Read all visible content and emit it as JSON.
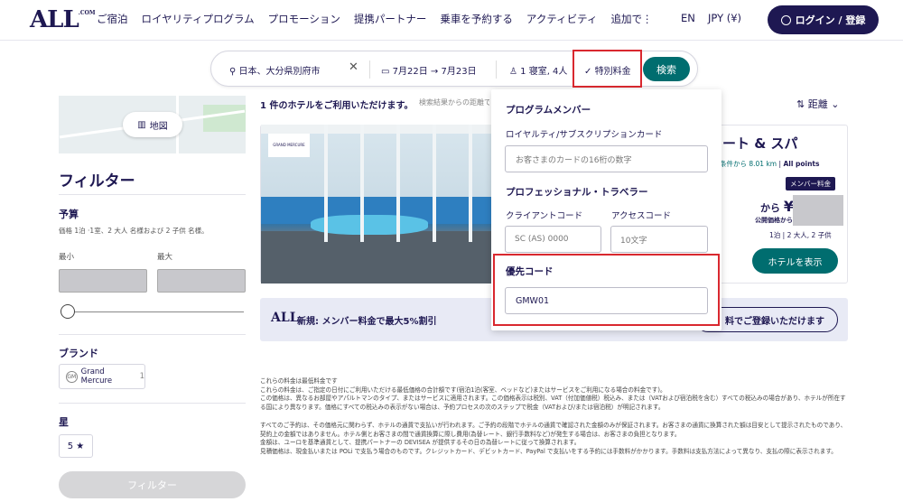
{
  "header": {
    "logo": "ALL",
    "logo_suffix": ".COM",
    "nav": [
      "ご宿泊",
      "ロイヤリティプログラム",
      "プロモーション",
      "提携パートナー",
      "乗車を予約する",
      "アクティビティ",
      "追加で⋮"
    ],
    "lang": "EN",
    "currency": "JPY (¥)",
    "login": "ログイン / 登録"
  },
  "search": {
    "location": "日本、大分県別府市",
    "clear": "✕",
    "date_from": "7月22日",
    "arrow": "→",
    "date_to": "7月23日",
    "rooms": "1 寝室, 4人",
    "special": "特別料金",
    "search_btn": "検索"
  },
  "sidebar": {
    "map_btn": "地図",
    "filter_title": "フィルター",
    "budget_title": "予算",
    "budget_note": "価格 1泊 ·1室、2 大人 名様および 2 子供 名様。",
    "min_label": "最小",
    "max_label": "最大",
    "brand_title": "ブランド",
    "brand_chip": "Grand Mercure",
    "brand_count": "1",
    "star_title": "星",
    "star_chip": "5 ★",
    "filter_btn": "フィルター"
  },
  "results": {
    "count": "1 件のホテルをご利用いただけます。",
    "note": "検索結果からの距離で",
    "sort": "距離",
    "hotel_name": "ート & スパ",
    "hotel_logo": "GRAND MERCURE",
    "dist_prefix": "条件から 8.01 km",
    "dist_sep": "|",
    "dist_points": "All points",
    "member_badge": "メンバー料金",
    "from": "から",
    "yen": "¥",
    "public_price": "公開価格から",
    "per_night": "1泊 | 2 大人, 2 子供",
    "show_btn": "ホテルを表示"
  },
  "promo": {
    "logo": "ALL",
    "text": "新規: メンバー料金で最大5%割引",
    "btn": "料でご登録いただけます"
  },
  "disclaimer": {
    "p1": "これらの料金は最低料金です",
    "p2": "これらの料金は、ご指定の日付にご利用いただける最低価格の合計額です(宿泊1泊(客室、ベッドなど)またはサービスをご利用になる場合の料金です)。",
    "p3": "この価格は、異なるお部屋やアパルトマンのタイプ、またはサービスに適用されます。この価格表示は税別、VAT（付加価値税）税込み、または（VATおよび宿泊税を含む）すべての税込みの場合があり、ホテルが所在する国により異なります。価格にすべての税込みの表示がない場合は、予約プロセスの次のステップで税金（VATおよび/または宿泊税）が明記されます。",
    "p4": "すべてのご予約は、その価格元に関わらず、ホテルの通貨で支払いが行われます。ご予約の段階でホテルの通貨で確認された金額のみが保証されます。お客さまの通貨に換算された額は目安として提示されたものであり、契約上の金額ではありません。ホテル側とお客さまの間で通貨換算に際し費用(為替レート、銀行手数料など)が発生する場合は、お客さまの負担となります。",
    "p5": "金額は、ユーロを基準通貨として、提携パートナーの DEVISEA が提供するその日の為替レートに従って換算されます。",
    "p6": "見積価格は、現金払いまたは POLi で支払う場合のものです。クレジットカード、デビットカード、PayPal で支払いをする予約には手数料がかかります。手数料は支払方法によって異なり、支払の際に表示されます。"
  },
  "dropdown": {
    "program_title": "プログラムメンバー",
    "loyalty_label": "ロイヤルティ/サブスクリプションカード",
    "card_placeholder": "お客さまのカードの16桁の数字",
    "pro_title": "プロフェッショナル・トラベラー",
    "client_label": "クライアントコード",
    "access_label": "アクセスコード",
    "client_placeholder": "SC (AS) 0000",
    "access_placeholder": "10文字",
    "pref_label": "優先コード",
    "pref_value": "GMW01"
  },
  "colors": {
    "navy": "#1e1852",
    "teal": "#006d6f",
    "highlight_red": "#d9282f"
  }
}
